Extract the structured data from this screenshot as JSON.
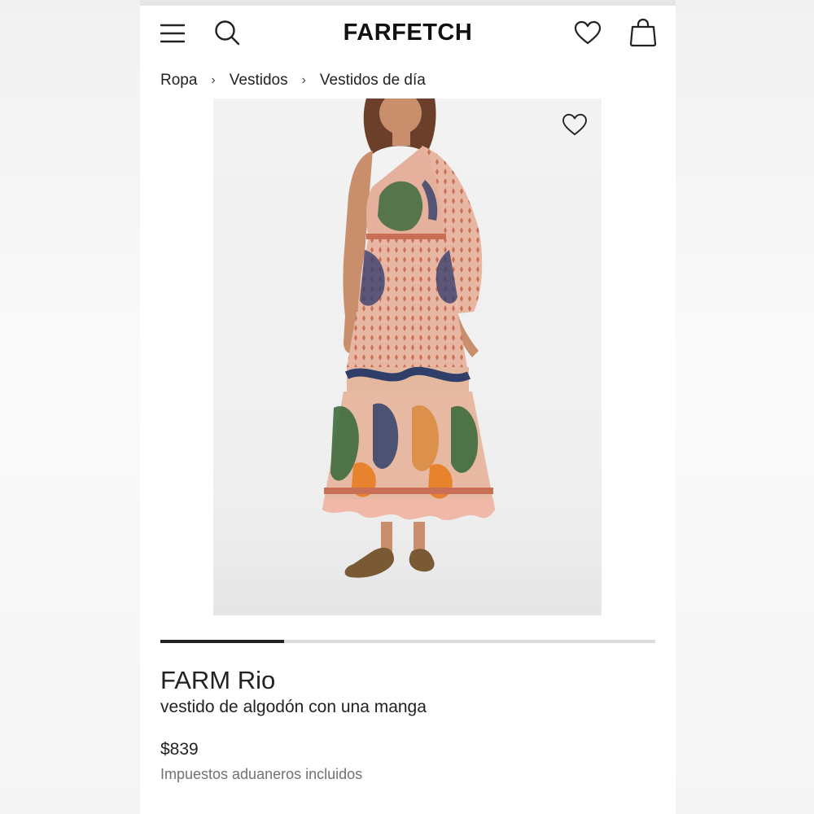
{
  "header": {
    "logo": "FARFETCH",
    "menu_icon": "hamburger-menu-icon",
    "search_icon": "search-icon",
    "wishlist_icon": "heart-icon",
    "bag_icon": "shopping-bag-icon"
  },
  "breadcrumb": {
    "items": [
      "Ropa",
      "Vestidos",
      "Vestidos de día"
    ],
    "separator": "›"
  },
  "product": {
    "image_alt": "FARM Rio vestido de algodón con una manga",
    "image_wish_icon": "heart-icon",
    "gallery_progress": 0.25,
    "brand": "FARM Rio",
    "name": "vestido de algodón con una manga",
    "price": "$839",
    "tax_note": "Impuestos aduaneros incluidos"
  },
  "colors": {
    "text": "#222222",
    "muted": "#727272",
    "background": "#ffffff",
    "image_bg": "#efefef"
  }
}
